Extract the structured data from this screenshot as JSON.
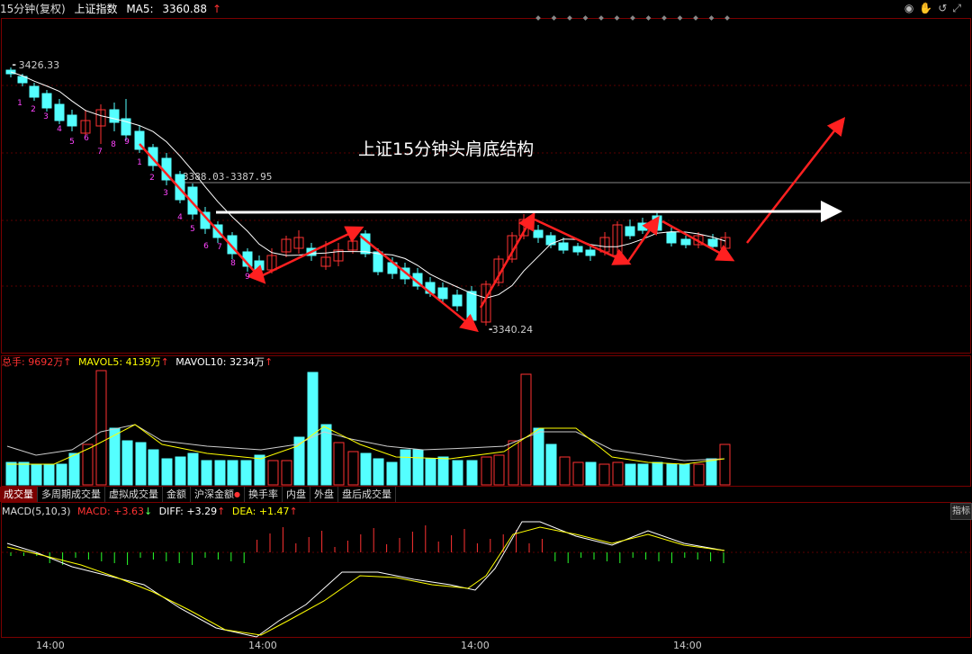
{
  "header": {
    "period": "15分钟(复权)",
    "index_name": "上证指数",
    "ma_label": "MA5:",
    "ma_value": "3360.88",
    "ma_arrow": "↑"
  },
  "price_labels": {
    "high": "3426.33",
    "resistance": "3388.03-3387.95",
    "low": "3340.24"
  },
  "annotation": "上证15分钟头肩底结构",
  "td_numbers": [
    "1",
    "2",
    "3",
    "4",
    "5",
    "6",
    "7",
    "8",
    "9",
    "1",
    "2",
    "3",
    "4",
    "5",
    "6",
    "7",
    "8",
    "9"
  ],
  "volume_legend": {
    "total_label": "总手:",
    "total_value": "9692万",
    "total_arrow": "↑",
    "mavol5_label": "MAVOL5:",
    "mavol5_value": "4139万",
    "mavol5_arrow": "↑",
    "mavol10_label": "MAVOL10:",
    "mavol10_value": "3234万",
    "mavol10_arrow": "↑"
  },
  "tabs": [
    "成交量",
    "多周期成交量",
    "虚拟成交量",
    "金额",
    "沪深金额",
    "换手率",
    "内盘",
    "外盘",
    "盘后成交量"
  ],
  "macd_legend": {
    "name": "MACD(5,10,3)",
    "macd_label": "MACD:",
    "macd_value": "+3.63",
    "macd_arrow": "↓",
    "diff_label": "DIFF:",
    "diff_value": "+3.29",
    "diff_arrow": "↑",
    "dea_label": "DEA:",
    "dea_value": "+1.47",
    "dea_arrow": "↑"
  },
  "right_button": "指标",
  "x_labels": [
    "14:00",
    "14:00",
    "14:00",
    "14:00"
  ],
  "icons": [
    "eye-icon",
    "hand-icon",
    "refresh-icon",
    "expand-icon"
  ],
  "colors": {
    "up": "#ff3232",
    "down": "#54ffff",
    "ma": "#ffffff",
    "yellow": "#ffff00",
    "arrow": "#ff2020"
  }
}
